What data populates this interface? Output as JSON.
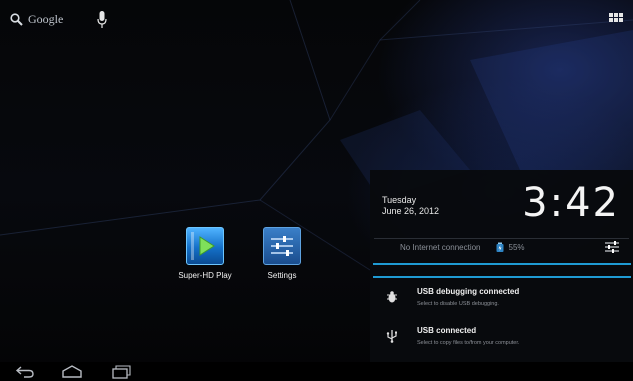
{
  "search": {
    "label": "Google",
    "icon": "search-icon"
  },
  "mic": {
    "icon": "microphone-icon"
  },
  "apps_button": {
    "icon": "all-apps-grid-icon"
  },
  "home_apps": [
    {
      "label": "Super-HD Play",
      "icon": "play-app-icon"
    },
    {
      "label": "Settings",
      "icon": "settings-app-icon"
    }
  ],
  "notification_panel": {
    "weekday": "Tuesday",
    "date": "June 26, 2012",
    "time": "3:42",
    "connection_status": "No Internet connection",
    "battery": "55%",
    "notifications": [
      {
        "title": "USB debugging connected",
        "subtitle": "Select to disable USB debugging.",
        "icon": "debug-bug-icon"
      },
      {
        "title": "USB connected",
        "subtitle": "Select to copy files to/from your computer.",
        "icon": "usb-icon"
      }
    ]
  },
  "navbar": {
    "icons": [
      "back-icon",
      "home-icon",
      "recent-apps-icon"
    ]
  },
  "colors": {
    "accent": "#1f9bd3",
    "panel_bg": "#08090e"
  }
}
